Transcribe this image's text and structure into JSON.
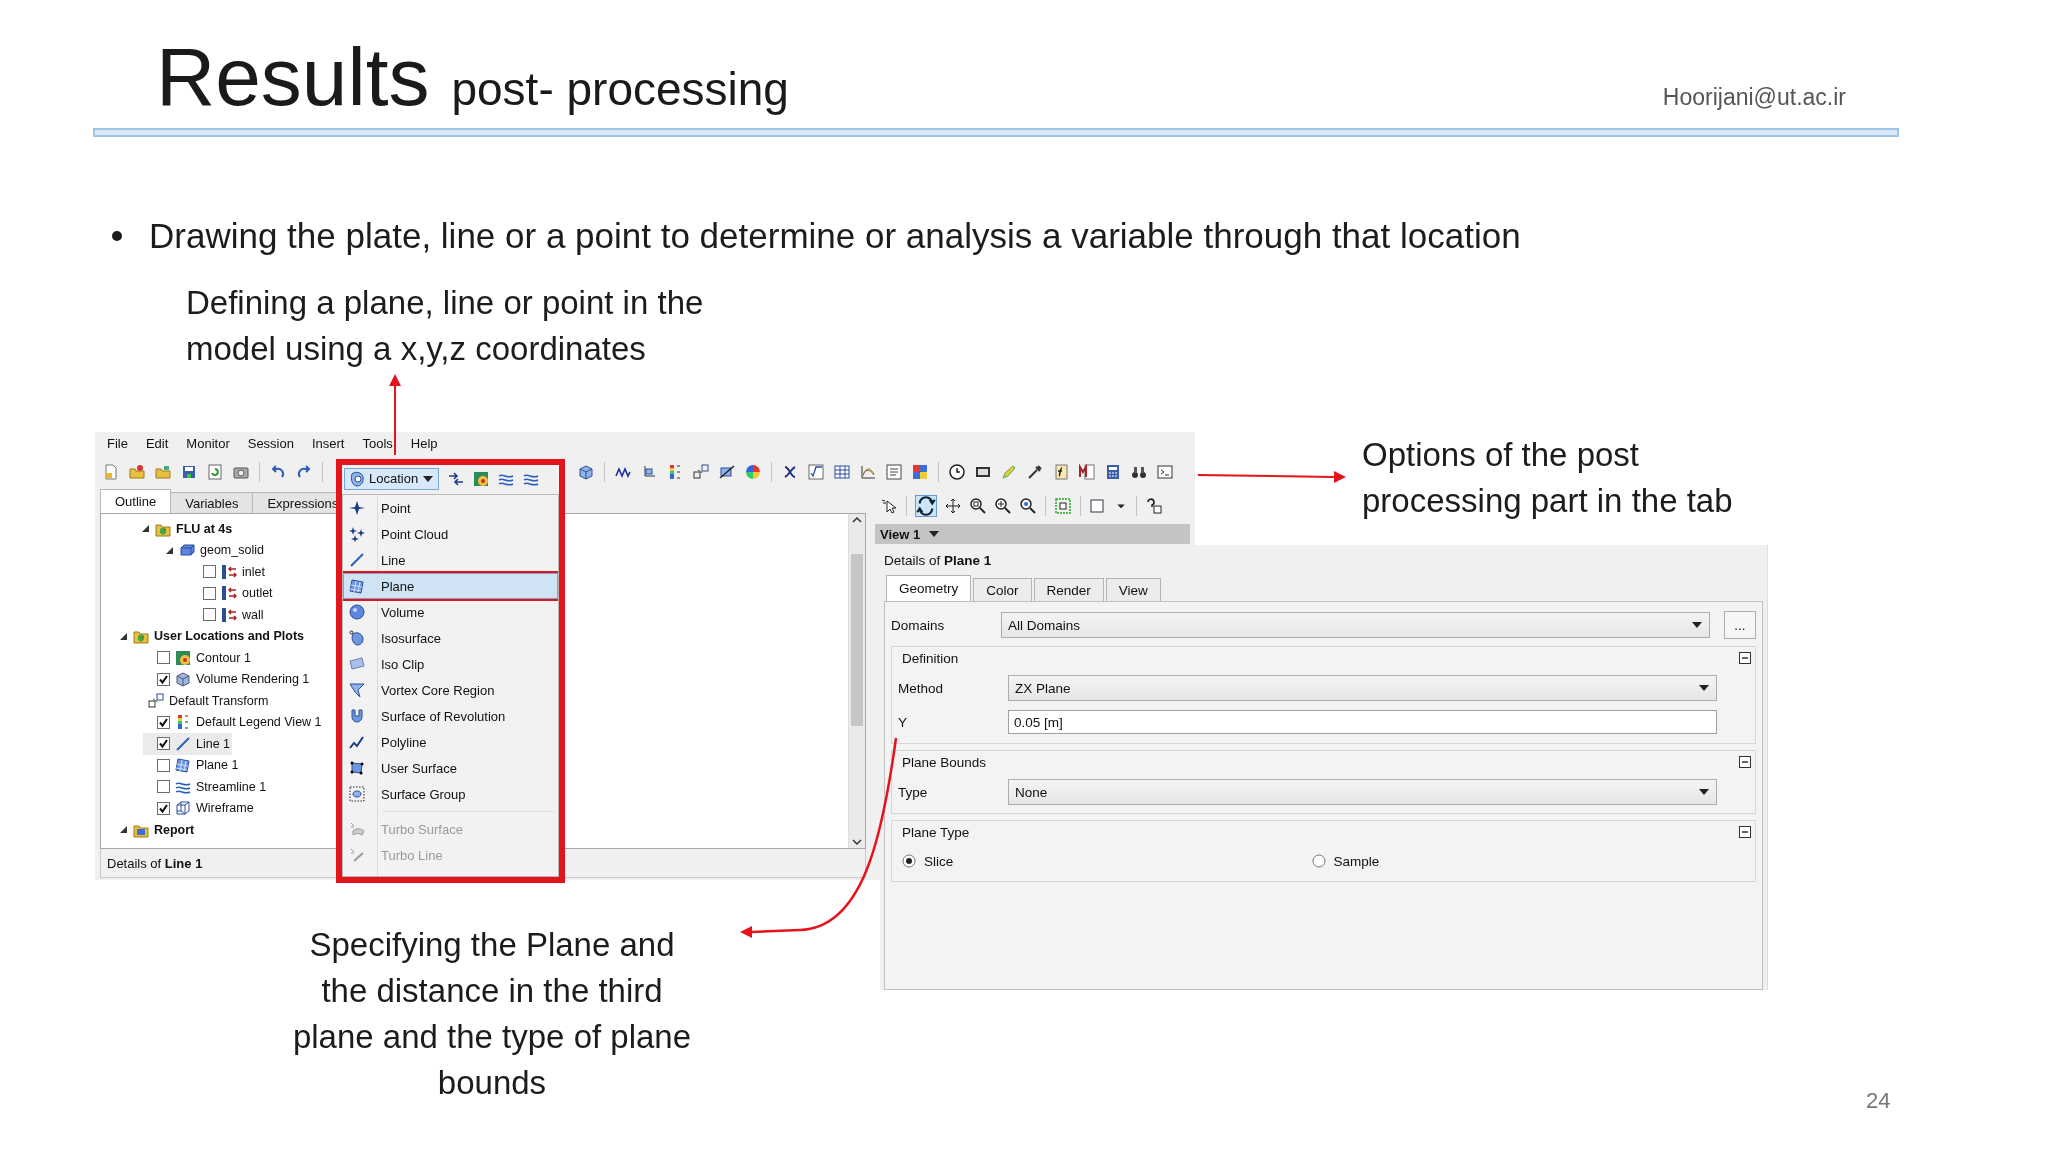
{
  "slide": {
    "title": "Results",
    "subtitle": "post- processing",
    "email": "Hoorijani@ut.ac.ir",
    "bullet": "Drawing the plate, line or a point to determine or analysis a variable through that location",
    "page_number": "24"
  },
  "notes": [
    {
      "kind": "top",
      "text": "Defining a plane, line or point in the\nmodel using a x,y,z coordinates"
    },
    {
      "kind": "right",
      "text": "Options of the post\nprocessing part in the tab"
    },
    {
      "kind": "bottom",
      "text": "Specifying the Plane and\nthe distance in the third\nplane and the type of plane\nbounds"
    }
  ],
  "app": {
    "menu": [
      "File",
      "Edit",
      "Monitor",
      "Session",
      "Insert",
      "Tools",
      "Help"
    ],
    "location_button": "Location",
    "panel_tabs": [
      {
        "label": "Outline",
        "selected": true
      },
      {
        "label": "Variables",
        "selected": false
      },
      {
        "label": "Expressions",
        "selected": false
      }
    ],
    "tree": [
      {
        "label": "FLU at 4s",
        "expanded": true,
        "selected": false,
        "children": [
          {
            "label": "geom_solid",
            "expanded": true,
            "selected": false,
            "children": [
              {
                "label": "inlet",
                "checked": false,
                "selected": false
              },
              {
                "label": "outlet",
                "checked": false,
                "selected": false
              },
              {
                "label": "wall",
                "checked": false,
                "selected": false
              }
            ]
          }
        ]
      },
      {
        "label": "User Locations and Plots",
        "expanded": true,
        "selected": false,
        "children": [
          {
            "label": "Contour 1",
            "checked": false,
            "selected": false
          },
          {
            "label": "Volume Rendering 1",
            "checked": true,
            "selected": false
          },
          {
            "label": "Default Transform",
            "selected": false
          },
          {
            "label": "Default Legend View 1",
            "checked": true,
            "selected": false
          },
          {
            "label": "Line 1",
            "checked": true,
            "selected": true
          },
          {
            "label": "Plane 1",
            "checked": false,
            "selected": false
          },
          {
            "label": "Streamline 1",
            "checked": false,
            "selected": false
          },
          {
            "label": "Wireframe",
            "checked": true,
            "selected": false
          }
        ]
      },
      {
        "label": "Report",
        "expanded": true,
        "selected": false
      }
    ],
    "footer": "Details of **Line 1**",
    "view_selector": "View 1",
    "location_menu": [
      {
        "label": "Point",
        "selected": false,
        "disabled": false
      },
      {
        "label": "Point Cloud",
        "selected": false,
        "disabled": false
      },
      {
        "label": "Line",
        "selected": false,
        "disabled": false
      },
      {
        "label": "Plane",
        "selected": true,
        "disabled": false
      },
      {
        "label": "Volume",
        "selected": false,
        "disabled": false
      },
      {
        "label": "Isosurface",
        "selected": false,
        "disabled": false
      },
      {
        "label": "Iso Clip",
        "selected": false,
        "disabled": false
      },
      {
        "label": "Vortex Core Region",
        "selected": false,
        "disabled": false
      },
      {
        "label": "Surface of Revolution",
        "selected": false,
        "disabled": false
      },
      {
        "label": "Polyline",
        "selected": false,
        "disabled": false
      },
      {
        "label": "User Surface",
        "selected": false,
        "disabled": false
      },
      {
        "label": "Surface Group",
        "selected": false,
        "disabled": false
      },
      {
        "label": "Turbo Surface",
        "selected": false,
        "disabled": true
      },
      {
        "label": "Turbo Line",
        "selected": false,
        "disabled": true
      }
    ]
  },
  "details": {
    "title": "Details of **Plane 1**",
    "tabs": [
      {
        "label": "Geometry",
        "selected": true
      },
      {
        "label": "Color",
        "selected": false
      },
      {
        "label": "Render",
        "selected": false
      },
      {
        "label": "View",
        "selected": false
      }
    ],
    "domains": {
      "label": "Domains",
      "value": "All Domains",
      "button": "..."
    },
    "groups": [
      {
        "title": "Definition",
        "expanded": true,
        "fields": [
          {
            "kind": "select",
            "label": "Method",
            "value": "ZX Plane"
          },
          {
            "kind": "input",
            "label": "Y",
            "value": "0.05 [m]"
          }
        ]
      },
      {
        "title": "Plane Bounds",
        "expanded": true,
        "fields": [
          {
            "kind": "select",
            "label": "Type",
            "value": "None"
          }
        ]
      },
      {
        "title": "Plane Type",
        "expanded": true,
        "fields": [
          {
            "kind": "radio",
            "options": [
              {
                "label": "Slice",
                "selected": true
              },
              {
                "label": "Sample",
                "selected": false
              }
            ]
          }
        ]
      }
    ]
  }
}
